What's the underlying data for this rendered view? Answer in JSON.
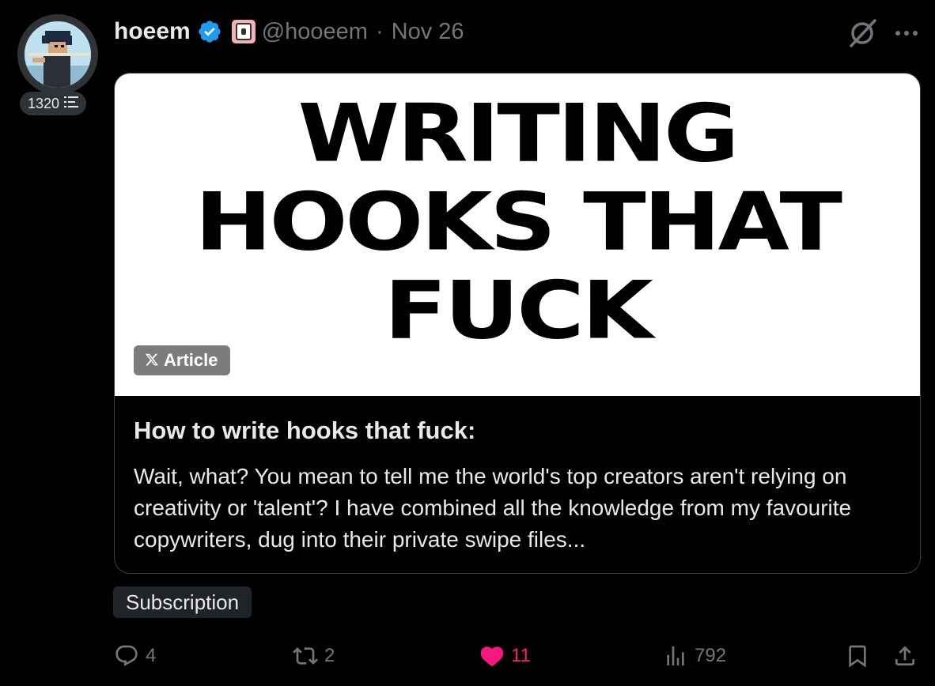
{
  "post": {
    "author_name": "hoeem",
    "handle": "@hooeem",
    "separator": "·",
    "date": "Nov 26",
    "score": "1320"
  },
  "article": {
    "hero_lines": [
      "WRITING",
      "HOOKS THAT",
      "FUCK"
    ],
    "badge_label": "Article",
    "title": "How to write hooks that fuck:",
    "excerpt": "Wait, what? You mean to tell me the world's top creators aren't relying on creativity or 'talent'? I have combined all the knowledge from my favourite copywriters, dug into their private swipe files..."
  },
  "subscription_label": "Subscription",
  "actions": {
    "replies": "4",
    "reposts": "2",
    "likes": "11",
    "views": "792"
  },
  "icons": {
    "verified": "verified-badge-icon",
    "affiliate": "affiliate-badge-icon",
    "grok": "grok-icon",
    "more": "more-icon",
    "reply": "reply-icon",
    "repost": "repost-icon",
    "like": "heart-icon",
    "views": "analytics-icon",
    "bookmark": "bookmark-icon",
    "share": "share-icon",
    "x_logo": "x-logo-icon"
  },
  "colors": {
    "background": "#000000",
    "text": "#e7e9ea",
    "muted": "#71767b",
    "verified": "#1d9bf0",
    "like": "#f91880"
  }
}
